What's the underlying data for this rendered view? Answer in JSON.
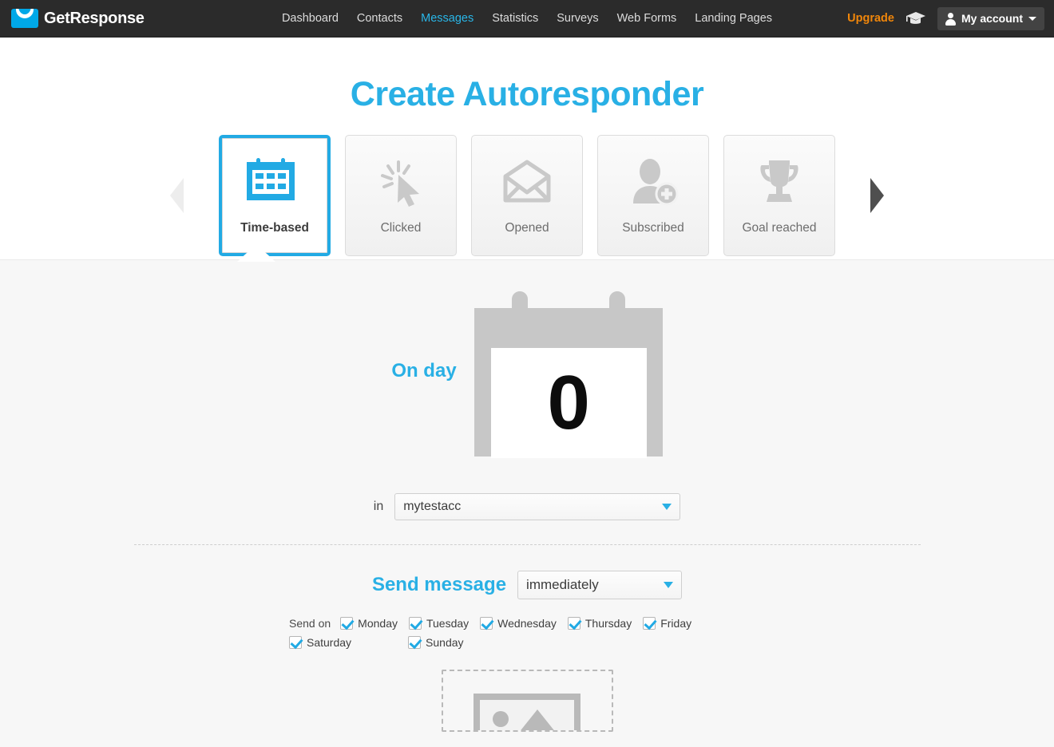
{
  "navbar": {
    "brand": "GetResponse",
    "links": [
      {
        "label": "Dashboard",
        "active": false
      },
      {
        "label": "Contacts",
        "active": false
      },
      {
        "label": "Messages",
        "active": true
      },
      {
        "label": "Statistics",
        "active": false
      },
      {
        "label": "Surveys",
        "active": false
      },
      {
        "label": "Web Forms",
        "active": false
      },
      {
        "label": "Landing Pages",
        "active": false
      }
    ],
    "upgrade_label": "Upgrade",
    "help_icon": "graduation-cap-icon",
    "account_label": "My account",
    "account_icon": "user-avatar-icon",
    "accent_blue": "#29b6e8",
    "upgrade_color": "#f0860a"
  },
  "page": {
    "title": "Create Autoresponder",
    "title_color": "#29b0e5"
  },
  "tabs": {
    "prev_arrow_icon": "chevron-left-icon",
    "next_arrow_icon": "chevron-right-icon",
    "items": [
      {
        "label": "Time-based",
        "icon": "calendar-icon",
        "selected": true
      },
      {
        "label": "Clicked",
        "icon": "cursor-click-icon",
        "selected": false
      },
      {
        "label": "Opened",
        "icon": "open-envelope-icon",
        "selected": false
      },
      {
        "label": "Subscribed",
        "icon": "user-add-icon",
        "selected": false
      },
      {
        "label": "Goal reached",
        "icon": "trophy-icon",
        "selected": false
      }
    ]
  },
  "form": {
    "on_day_label": "On day",
    "day_number": "0",
    "in_label": "in",
    "account_value": "mytestacc",
    "send_message_label": "Send message",
    "send_timing_value": "immediately",
    "send_on_label": "Send on",
    "days": [
      {
        "label": "Monday",
        "checked": true
      },
      {
        "label": "Tuesday",
        "checked": true
      },
      {
        "label": "Wednesday",
        "checked": true
      },
      {
        "label": "Thursday",
        "checked": true
      },
      {
        "label": "Friday",
        "checked": true
      },
      {
        "label": "Saturday",
        "checked": true
      },
      {
        "label": "Sunday",
        "checked": true
      }
    ],
    "dropzone_icon": "image-placeholder-icon",
    "checkbox_color": "#22aae4"
  }
}
